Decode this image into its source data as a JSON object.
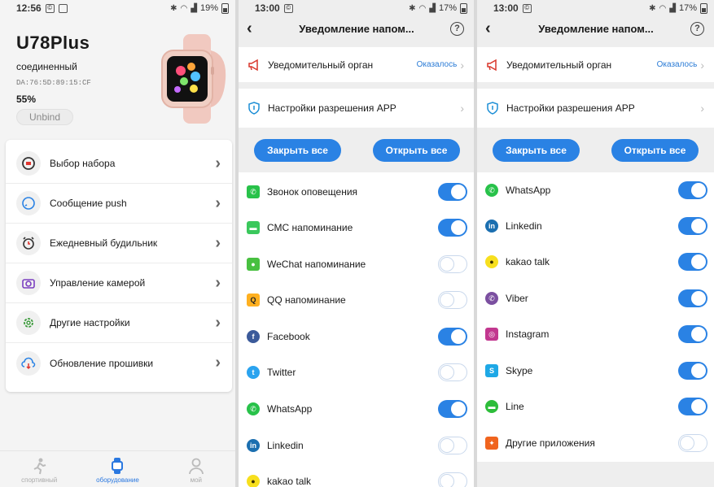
{
  "panel1": {
    "status": {
      "time": "12:56",
      "battery": "19%"
    },
    "device": {
      "name": "U78Plus",
      "status": "соединенный",
      "mac": "DA:76:5D:89:15:CF",
      "battery": "55%",
      "unbind_label": "Unbind"
    },
    "menu": [
      {
        "label": "Выбор набора",
        "icon": "watchface-icon"
      },
      {
        "label": "Сообщение push",
        "icon": "message-icon"
      },
      {
        "label": "Ежедневный будильник",
        "icon": "alarm-icon"
      },
      {
        "label": "Управление камерой",
        "icon": "camera-icon"
      },
      {
        "label": "Другие настройки",
        "icon": "gear-icon"
      },
      {
        "label": "Обновление прошивки",
        "icon": "cloud-download-icon"
      }
    ],
    "tabs": [
      {
        "label": "спортивный",
        "active": false
      },
      {
        "label": "оборудование",
        "active": true
      },
      {
        "label": "мой",
        "active": false
      }
    ]
  },
  "panel2": {
    "status": {
      "time": "13:00",
      "battery": "17%"
    },
    "title": "Уведомление напом...",
    "notify_body_label": "Уведомительный орган",
    "notify_body_value": "Оказалось",
    "app_permission_label": "Настройки разрешения APP",
    "close_all": "Закрыть все",
    "open_all": "Открыть все",
    "apps": [
      {
        "label": "Звонок оповещения",
        "on": true,
        "color": "#28c24a",
        "icon": "phone-icon"
      },
      {
        "label": "СМС напоминание",
        "on": true,
        "color": "#3ac85c",
        "icon": "sms-icon"
      },
      {
        "label": "WeChat напоминание",
        "on": false,
        "color": "#48c040",
        "icon": "wechat-icon"
      },
      {
        "label": "QQ напоминание",
        "on": false,
        "color": "#222222",
        "icon": "qq-icon"
      },
      {
        "label": "Facebook",
        "on": true,
        "color": "#3b5a9a",
        "icon": "facebook-icon"
      },
      {
        "label": "Twitter",
        "on": false,
        "color": "#2aa3ef",
        "icon": "twitter-icon"
      },
      {
        "label": "WhatsApp",
        "on": true,
        "color": "#28c24a",
        "icon": "whatsapp-icon"
      },
      {
        "label": "Linkedin",
        "on": false,
        "color": "#1b6fb0",
        "icon": "linkedin-icon"
      },
      {
        "label": "kakao talk",
        "on": false,
        "color": "#f7df1e",
        "icon": "kakao-icon"
      }
    ]
  },
  "panel3": {
    "status": {
      "time": "13:00",
      "battery": "17%"
    },
    "title": "Уведомление напом...",
    "notify_body_label": "Уведомительный орган",
    "notify_body_value": "Оказалось",
    "app_permission_label": "Настройки разрешения APP",
    "close_all": "Закрыть все",
    "open_all": "Открыть все",
    "apps": [
      {
        "label": "WhatsApp",
        "on": true,
        "color": "#28c24a",
        "icon": "whatsapp-icon"
      },
      {
        "label": "Linkedin",
        "on": true,
        "color": "#1b6fb0",
        "icon": "linkedin-icon"
      },
      {
        "label": "kakao talk",
        "on": true,
        "color": "#f7df1e",
        "icon": "kakao-icon"
      },
      {
        "label": "Viber",
        "on": true,
        "color": "#7b4fa0",
        "icon": "viber-icon"
      },
      {
        "label": "Instagram",
        "on": true,
        "color": "#c2378f",
        "icon": "instagram-icon"
      },
      {
        "label": "Skype",
        "on": true,
        "color": "#1ea8e6",
        "icon": "skype-icon"
      },
      {
        "label": "Line",
        "on": true,
        "color": "#2dbd3a",
        "icon": "line-icon"
      },
      {
        "label": "Другие приложения",
        "on": false,
        "color": "#f0641e",
        "icon": "other-apps-icon"
      }
    ]
  },
  "colors": {
    "accent": "#2a82e4",
    "link": "#2a7bd6"
  }
}
